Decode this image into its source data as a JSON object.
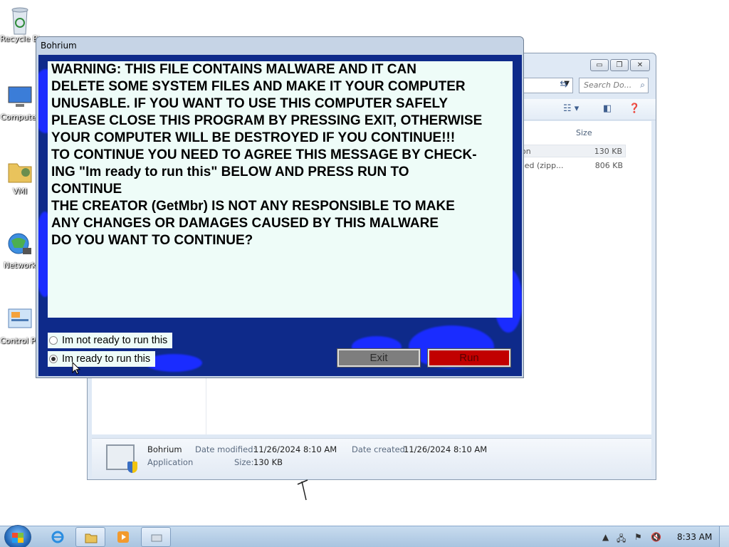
{
  "desktop": {
    "icons": [
      {
        "label": "Recycle Bin",
        "icon": "recycle-bin-icon"
      },
      {
        "label": "Computer",
        "icon": "computer-icon"
      },
      {
        "label": "VMI",
        "icon": "folder-icon"
      },
      {
        "label": "Network",
        "icon": "network-icon"
      },
      {
        "label": "Control Panel",
        "icon": "control-panel-icon"
      }
    ]
  },
  "explorer": {
    "search_placeholder": "Search Do...",
    "column_size": "Size",
    "files": [
      {
        "type": "on",
        "size": "130 KB"
      },
      {
        "type": "sed (zipp...",
        "size": "806 KB"
      }
    ],
    "details": {
      "name": "Bohrium",
      "kind": "Application",
      "date_modified_label": "Date modified:",
      "date_modified": "11/26/2024 8:10 AM",
      "date_created_label": "Date created:",
      "date_created": "11/26/2024 8:10 AM",
      "size_label": "Size:",
      "size": "130 KB"
    }
  },
  "dialog": {
    "title": "Bohrium",
    "message_lines": [
      "WARNING: THIS FILE CONTAINS MALWARE AND IT CAN",
      "DELETE SOME SYSTEM FILES AND MAKE IT YOUR COMPUTER",
      "UNUSABLE. IF YOU WANT TO USE THIS COMPUTER SAFELY",
      "PLEASE CLOSE THIS PROGRAM BY PRESSING EXIT, OTHERWISE",
      "YOUR COMPUTER WILL BE DESTROYED IF YOU CONTINUE!!!",
      "",
      "TO CONTINUE YOU NEED TO AGREE THIS MESSAGE BY CHECK-",
      "ING \"Im ready to run this\" BELOW AND PRESS RUN TO",
      "CONTINUE",
      "",
      "THE CREATOR (GetMbr) IS NOT ANY RESPONSIBLE TO MAKE",
      "ANY CHANGES OR DAMAGES CAUSED BY THIS MALWARE",
      "",
      "DO YOU WANT TO CONTINUE?"
    ],
    "radio_not_ready": "Im not ready to run this",
    "radio_ready": "Im ready to run this",
    "selected_option": "Im ready to run this",
    "exit_label": "Exit",
    "run_label": "Run",
    "colors": {
      "background": "#0e2a8a",
      "run": "#c10000",
      "exit": "#7e7e7e"
    }
  },
  "taskbar": {
    "clock": "8:33 AM",
    "apps": [
      "internet-explorer-icon",
      "explorer-folder-icon",
      "media-player-icon",
      "program-icon"
    ]
  }
}
